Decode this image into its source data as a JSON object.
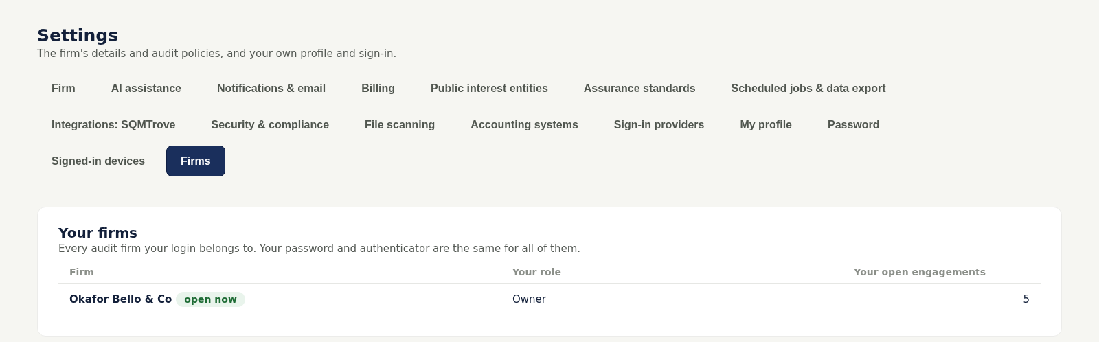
{
  "header": {
    "title": "Settings",
    "subtitle": "The firm's details and audit policies, and your own profile and sign-in."
  },
  "tabs": [
    {
      "label": "Firm",
      "selected": false
    },
    {
      "label": "AI assistance",
      "selected": false
    },
    {
      "label": "Notifications & email",
      "selected": false
    },
    {
      "label": "Billing",
      "selected": false
    },
    {
      "label": "Public interest entities",
      "selected": false
    },
    {
      "label": "Assurance standards",
      "selected": false
    },
    {
      "label": "Scheduled jobs & data export",
      "selected": false
    },
    {
      "label": "Integrations: SQMTrove",
      "selected": false
    },
    {
      "label": "Security & compliance",
      "selected": false
    },
    {
      "label": "File scanning",
      "selected": false
    },
    {
      "label": "Accounting systems",
      "selected": false
    },
    {
      "label": "Sign-in providers",
      "selected": false
    },
    {
      "label": "My profile",
      "selected": false
    },
    {
      "label": "Password",
      "selected": false
    },
    {
      "label": "Signed-in devices",
      "selected": false
    },
    {
      "label": "Firms",
      "selected": true
    }
  ],
  "card": {
    "title": "Your firms",
    "description": "Every audit firm your login belongs to. Your password and authenticator are the same for all of them.",
    "table": {
      "columns": [
        "Firm",
        "Your role",
        "Your open engagements"
      ],
      "rows": [
        {
          "firm": "Okafor Bello & Co",
          "badge": "open now",
          "role": "Owner",
          "open_engagements": "5"
        }
      ]
    }
  }
}
